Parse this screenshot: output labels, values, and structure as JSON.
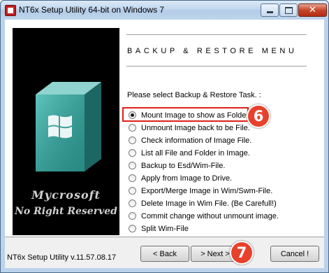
{
  "window": {
    "title": "NT6x Setup Utility 64-bit on Windows 7",
    "controls": {
      "minimize": "minimize",
      "maximize": "maximize",
      "close": "✕"
    }
  },
  "sidebar": {
    "brand_name": "Mycrosoft",
    "brand_tagline": "No Right Reserved"
  },
  "menu": {
    "title": "BACKUP & RESTORE MENU",
    "prompt": "Please select Backup & Restore Task. :",
    "selected_index": 0,
    "options": [
      "Mount Image to show as Folder.",
      "Unmount Image back to be File.",
      "Check information of Image File.",
      "List all File and Folder in Image.",
      "Backup to Esd/Wim-File.",
      "Apply from Image to Drive.",
      "Export/Merge Image in Wim/Swm-File.",
      "Delete Image in Wim File. (Be Carefull!)",
      "Commit change without unmount image.",
      "Split Wim-File"
    ]
  },
  "footer": {
    "version": "NT6x Setup Utility v.11.57.08.17",
    "back_label": "< Back",
    "next_label": "> Next >",
    "cancel_label": "Cancel !"
  },
  "annotations": {
    "step_a": "6",
    "step_b": "7",
    "color": "#e8412b"
  }
}
